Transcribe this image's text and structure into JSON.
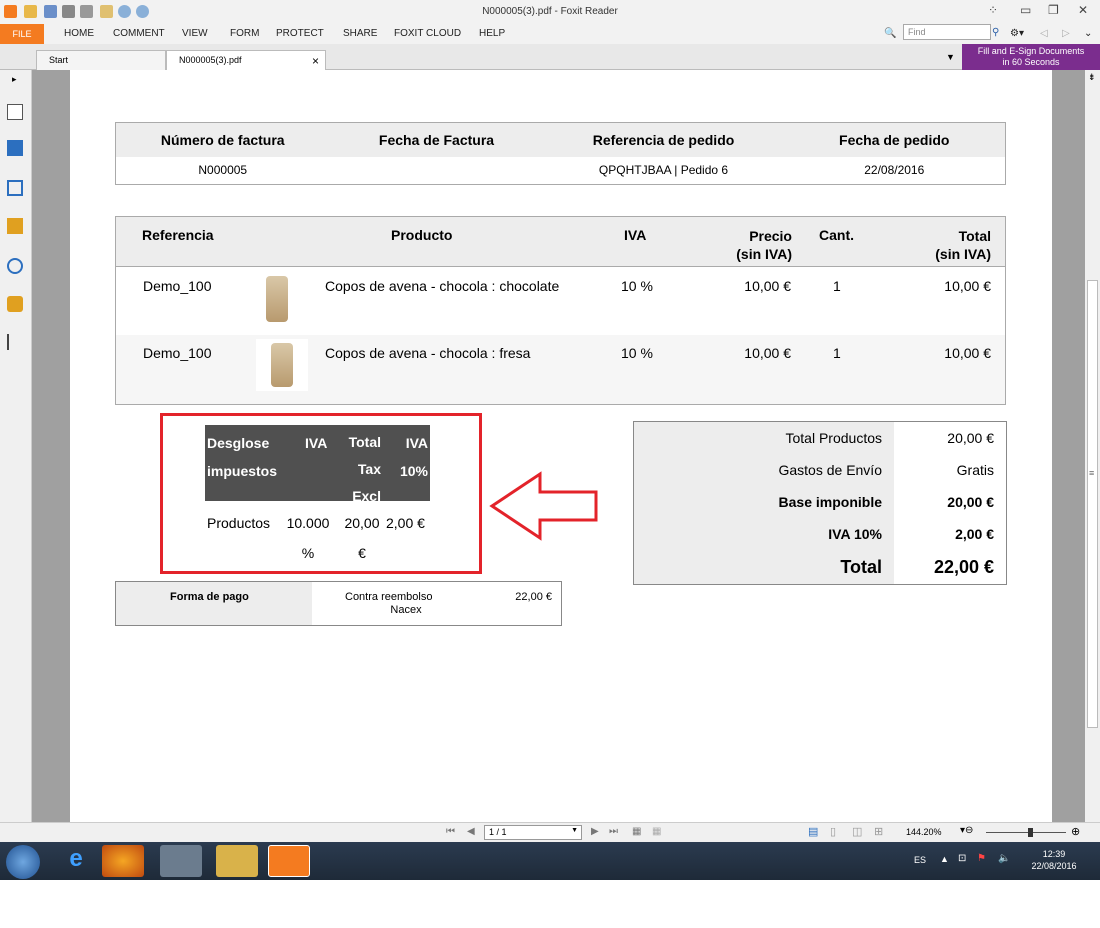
{
  "window": {
    "title": "N000005(3).pdf - Foxit Reader"
  },
  "menu": {
    "file": "FILE",
    "items": [
      "HOME",
      "COMMENT",
      "VIEW",
      "FORM",
      "PROTECT",
      "SHARE",
      "FOXIT CLOUD",
      "HELP"
    ]
  },
  "find": {
    "placeholder": "Find"
  },
  "tabs": {
    "start": "Start",
    "doc": "N000005(3).pdf",
    "close": "×"
  },
  "promo": {
    "line1": "Fill and E-Sign Documents",
    "line2": "in 60 Seconds"
  },
  "invoice_header": {
    "cols": [
      "Número de factura",
      "Fecha de Factura",
      "Referencia de pedido",
      "Fecha de pedido"
    ],
    "values": [
      "N000005",
      "",
      "QPQHTJBAA | Pedido 6",
      "22/08/2016"
    ]
  },
  "products": {
    "headers": {
      "ref": "Referencia",
      "product": "Producto",
      "iva": "IVA",
      "price1": "Precio",
      "price2": "(sin IVA)",
      "qty": "Cant.",
      "total1": "Total",
      "total2": "(sin IVA)"
    },
    "rows": [
      {
        "ref": "Demo_100",
        "name": "Copos de avena - chocola : chocolate",
        "iva": "10 %",
        "price": "10,00 €",
        "qty": "1",
        "total": "10,00 €"
      },
      {
        "ref": "Demo_100",
        "name": "Copos de avena - chocola : fresa",
        "iva": "10 %",
        "price": "10,00 €",
        "qty": "1",
        "total": "10,00 €"
      }
    ]
  },
  "tax": {
    "h1a": "Desglose",
    "h1b": "impuestos",
    "h2": "IVA",
    "h3a": "Total",
    "h3b": "Tax",
    "h3c": "Excl",
    "h4a": "IVA",
    "h4b": "10%",
    "row": {
      "label": "Productos",
      "iva1": "10.000",
      "iva2": "%",
      "excl1": "20,00",
      "excl2": "€",
      "iva": "2,00 €"
    }
  },
  "totals": [
    {
      "label": "Total Productos",
      "value": "20,00 €",
      "bold": false
    },
    {
      "label": "Gastos de Envío",
      "value": "Gratis",
      "bold": false
    },
    {
      "label": "Base imponible",
      "value": "20,00 €",
      "bold": true
    },
    {
      "label": "IVA 10%",
      "value": "2,00 €",
      "bold": true
    },
    {
      "label": "Total",
      "value": "22,00 €",
      "bold": true
    }
  ],
  "payment": {
    "label": "Forma de pago",
    "method1": "Contra reembolso",
    "method2": "Nacex",
    "amount": "22,00 €"
  },
  "status": {
    "page": "1 / 1",
    "zoom": "144.20%"
  },
  "taskbar": {
    "lang": "ES",
    "time": "12:39",
    "date": "22/08/2016"
  },
  "colors": {
    "accent": "#f47b20",
    "red_box": "#e3232a",
    "promo": "#7b2d8e"
  }
}
